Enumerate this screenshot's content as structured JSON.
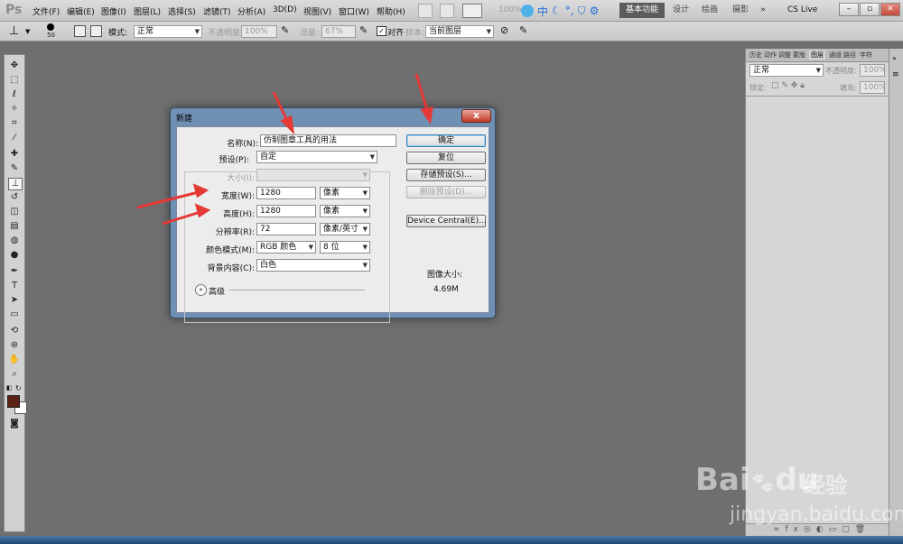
{
  "app": {
    "logo": "Ps",
    "menu": [
      "文件(F)",
      "编辑(E)",
      "图像(I)",
      "图层(L)",
      "选择(S)",
      "滤镜(T)",
      "分析(A)",
      "3D(D)",
      "视图(V)",
      "窗口(W)",
      "帮助(H)"
    ],
    "zoom": "100%",
    "ime_label": "中",
    "workspaces": {
      "active": "基本功能",
      "items": [
        "设计",
        "绘画",
        "摄影"
      ]
    },
    "cs_live": "CS Live"
  },
  "options_bar": {
    "brush_size": "50",
    "mode_label": "模式:",
    "mode_value": "正常",
    "opacity_label": "不透明度:",
    "opacity_value": "100%",
    "flow_label": "流量:",
    "flow_value": "67%",
    "align_label": "对齐",
    "sample_label": "样本:",
    "sample_value": "当前图层"
  },
  "right_panel": {
    "tabs": [
      "历史",
      "动作",
      "调整",
      "蒙版",
      "图层",
      "通道",
      "路径",
      "字符"
    ],
    "active_tab": "图层",
    "blend_mode": "正常",
    "opacity_label": "不透明度:",
    "opacity_value": "100%",
    "lock_label": "锁定:",
    "fill_label": "填充:",
    "fill_value": "100%"
  },
  "dialog": {
    "title": "新建",
    "close": "x",
    "name_label": "名称(N):",
    "name_value": "仿制图章工具的用法",
    "preset_label": "预设(P):",
    "preset_value": "自定",
    "size_label": "大小(I):",
    "width_label": "宽度(W):",
    "width_value": "1280",
    "width_unit": "像素",
    "height_label": "高度(H):",
    "height_value": "1280",
    "height_unit": "像素",
    "resolution_label": "分辨率(R):",
    "resolution_value": "72",
    "resolution_unit": "像素/英寸",
    "color_mode_label": "颜色模式(M):",
    "color_mode_value": "RGB 颜色",
    "bit_depth": "8 位",
    "background_label": "背景内容(C):",
    "background_value": "白色",
    "advanced_label": "高级",
    "buttons": {
      "ok": "确定",
      "reset": "复位",
      "save_preset": "存储预设(S)...",
      "delete_preset": "删除预设(D)...",
      "device_central": "Device Central(E)..."
    },
    "image_size_label": "图像大小:",
    "image_size_value": "4.69M"
  },
  "watermark": {
    "logo": "Bai",
    "logo_suffix": "du",
    "brand": "经验",
    "url": "jingyan.baidu.com"
  },
  "colors": {
    "arrow": "#e53935",
    "foreground": "#5a2414",
    "background": "#ffffff"
  }
}
